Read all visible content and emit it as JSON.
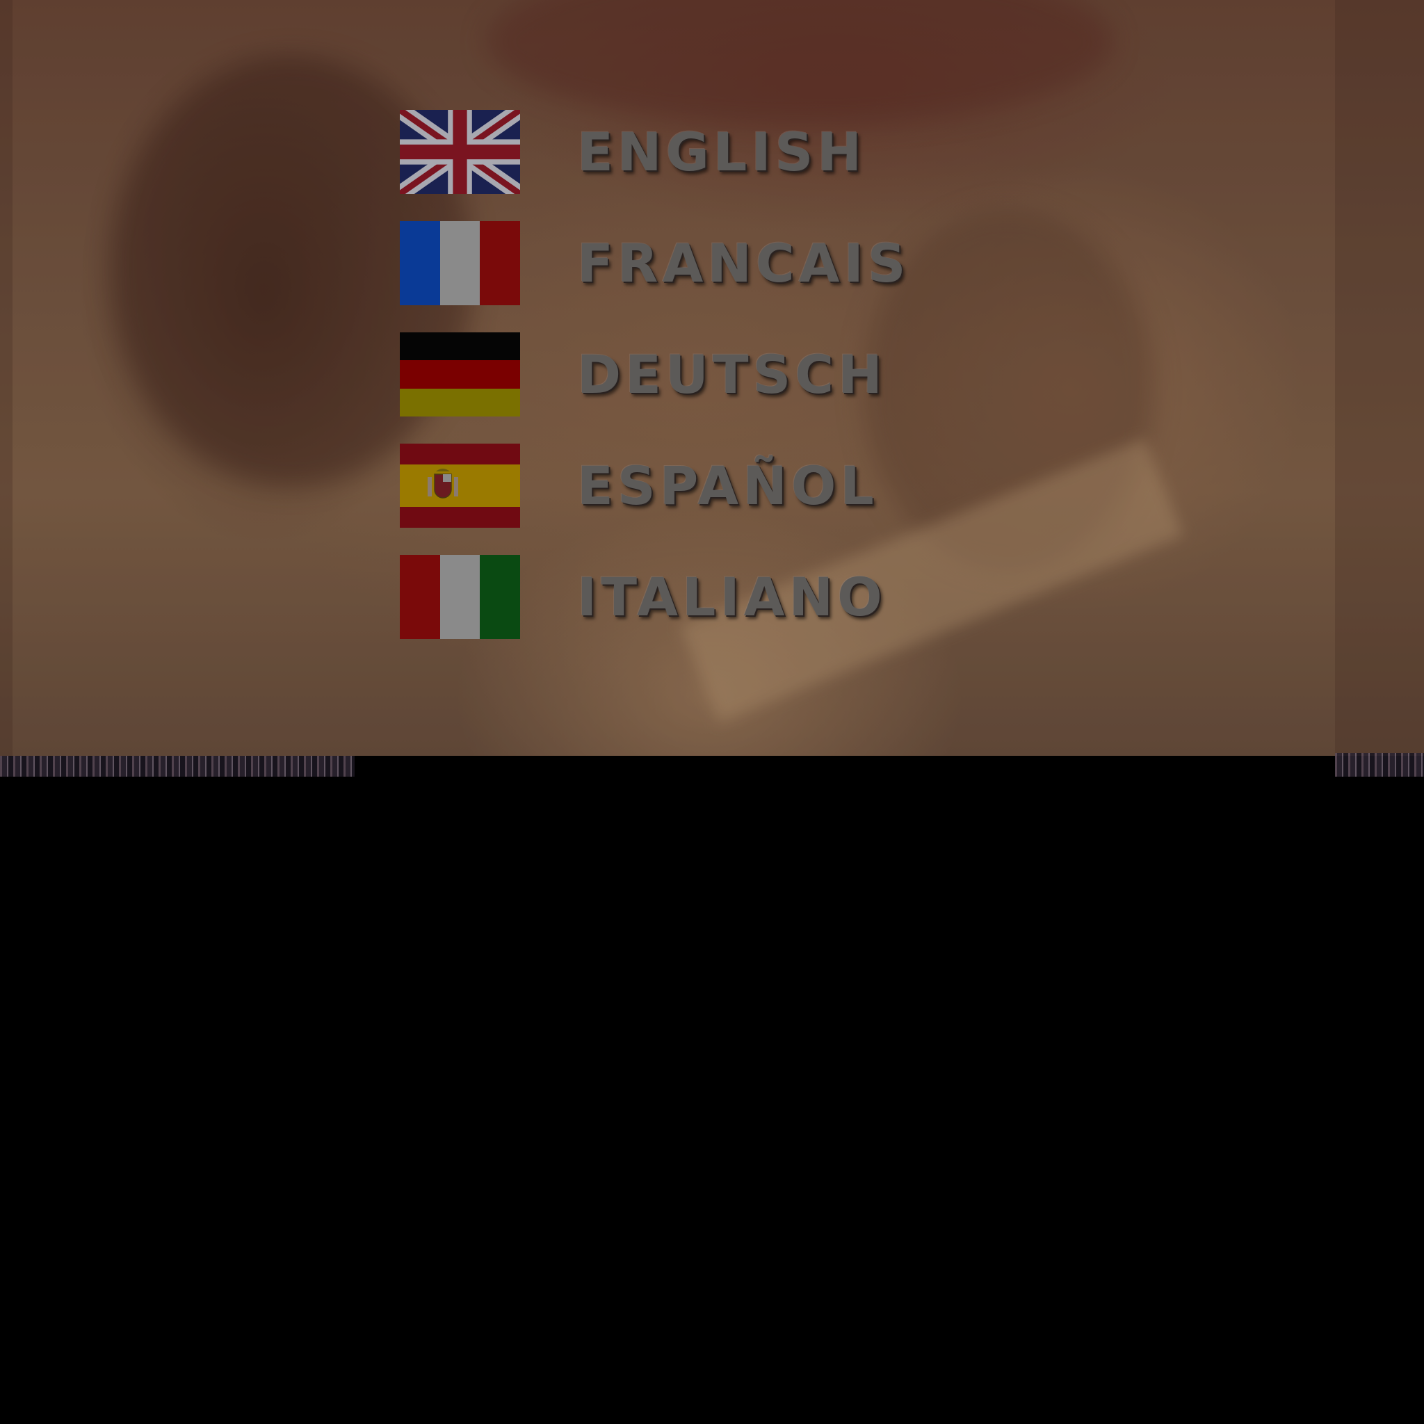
{
  "screen": "language-select",
  "languages": [
    {
      "label": "ENGLISH",
      "flag_icon": "uk-flag-icon"
    },
    {
      "label": "FRANCAIS",
      "flag_icon": "france-flag-icon"
    },
    {
      "label": "DEUTSCH",
      "flag_icon": "germany-flag-icon"
    },
    {
      "label": "ESPAÑOL",
      "flag_icon": "spain-flag-icon"
    },
    {
      "label": "ITALIANO",
      "flag_icon": "italy-flag-icon"
    }
  ],
  "colors": {
    "label_text": "#5c5a58",
    "uk_blue": "#1a2150",
    "uk_red": "#7a1420",
    "uk_white": "#a8a8b0",
    "france_blue": "#0a3a96",
    "france_white": "#8a8a8a",
    "france_red": "#7a0a0a",
    "germany_black": "#050505",
    "germany_red": "#7a0000",
    "germany_gold": "#7a7000",
    "spain_red": "#700a12",
    "spain_yellow": "#9a7a00",
    "italy_red": "#7a0a0a",
    "italy_white": "#8a8a8a",
    "italy_green": "#0a4a12",
    "lower_area": "#000000"
  }
}
